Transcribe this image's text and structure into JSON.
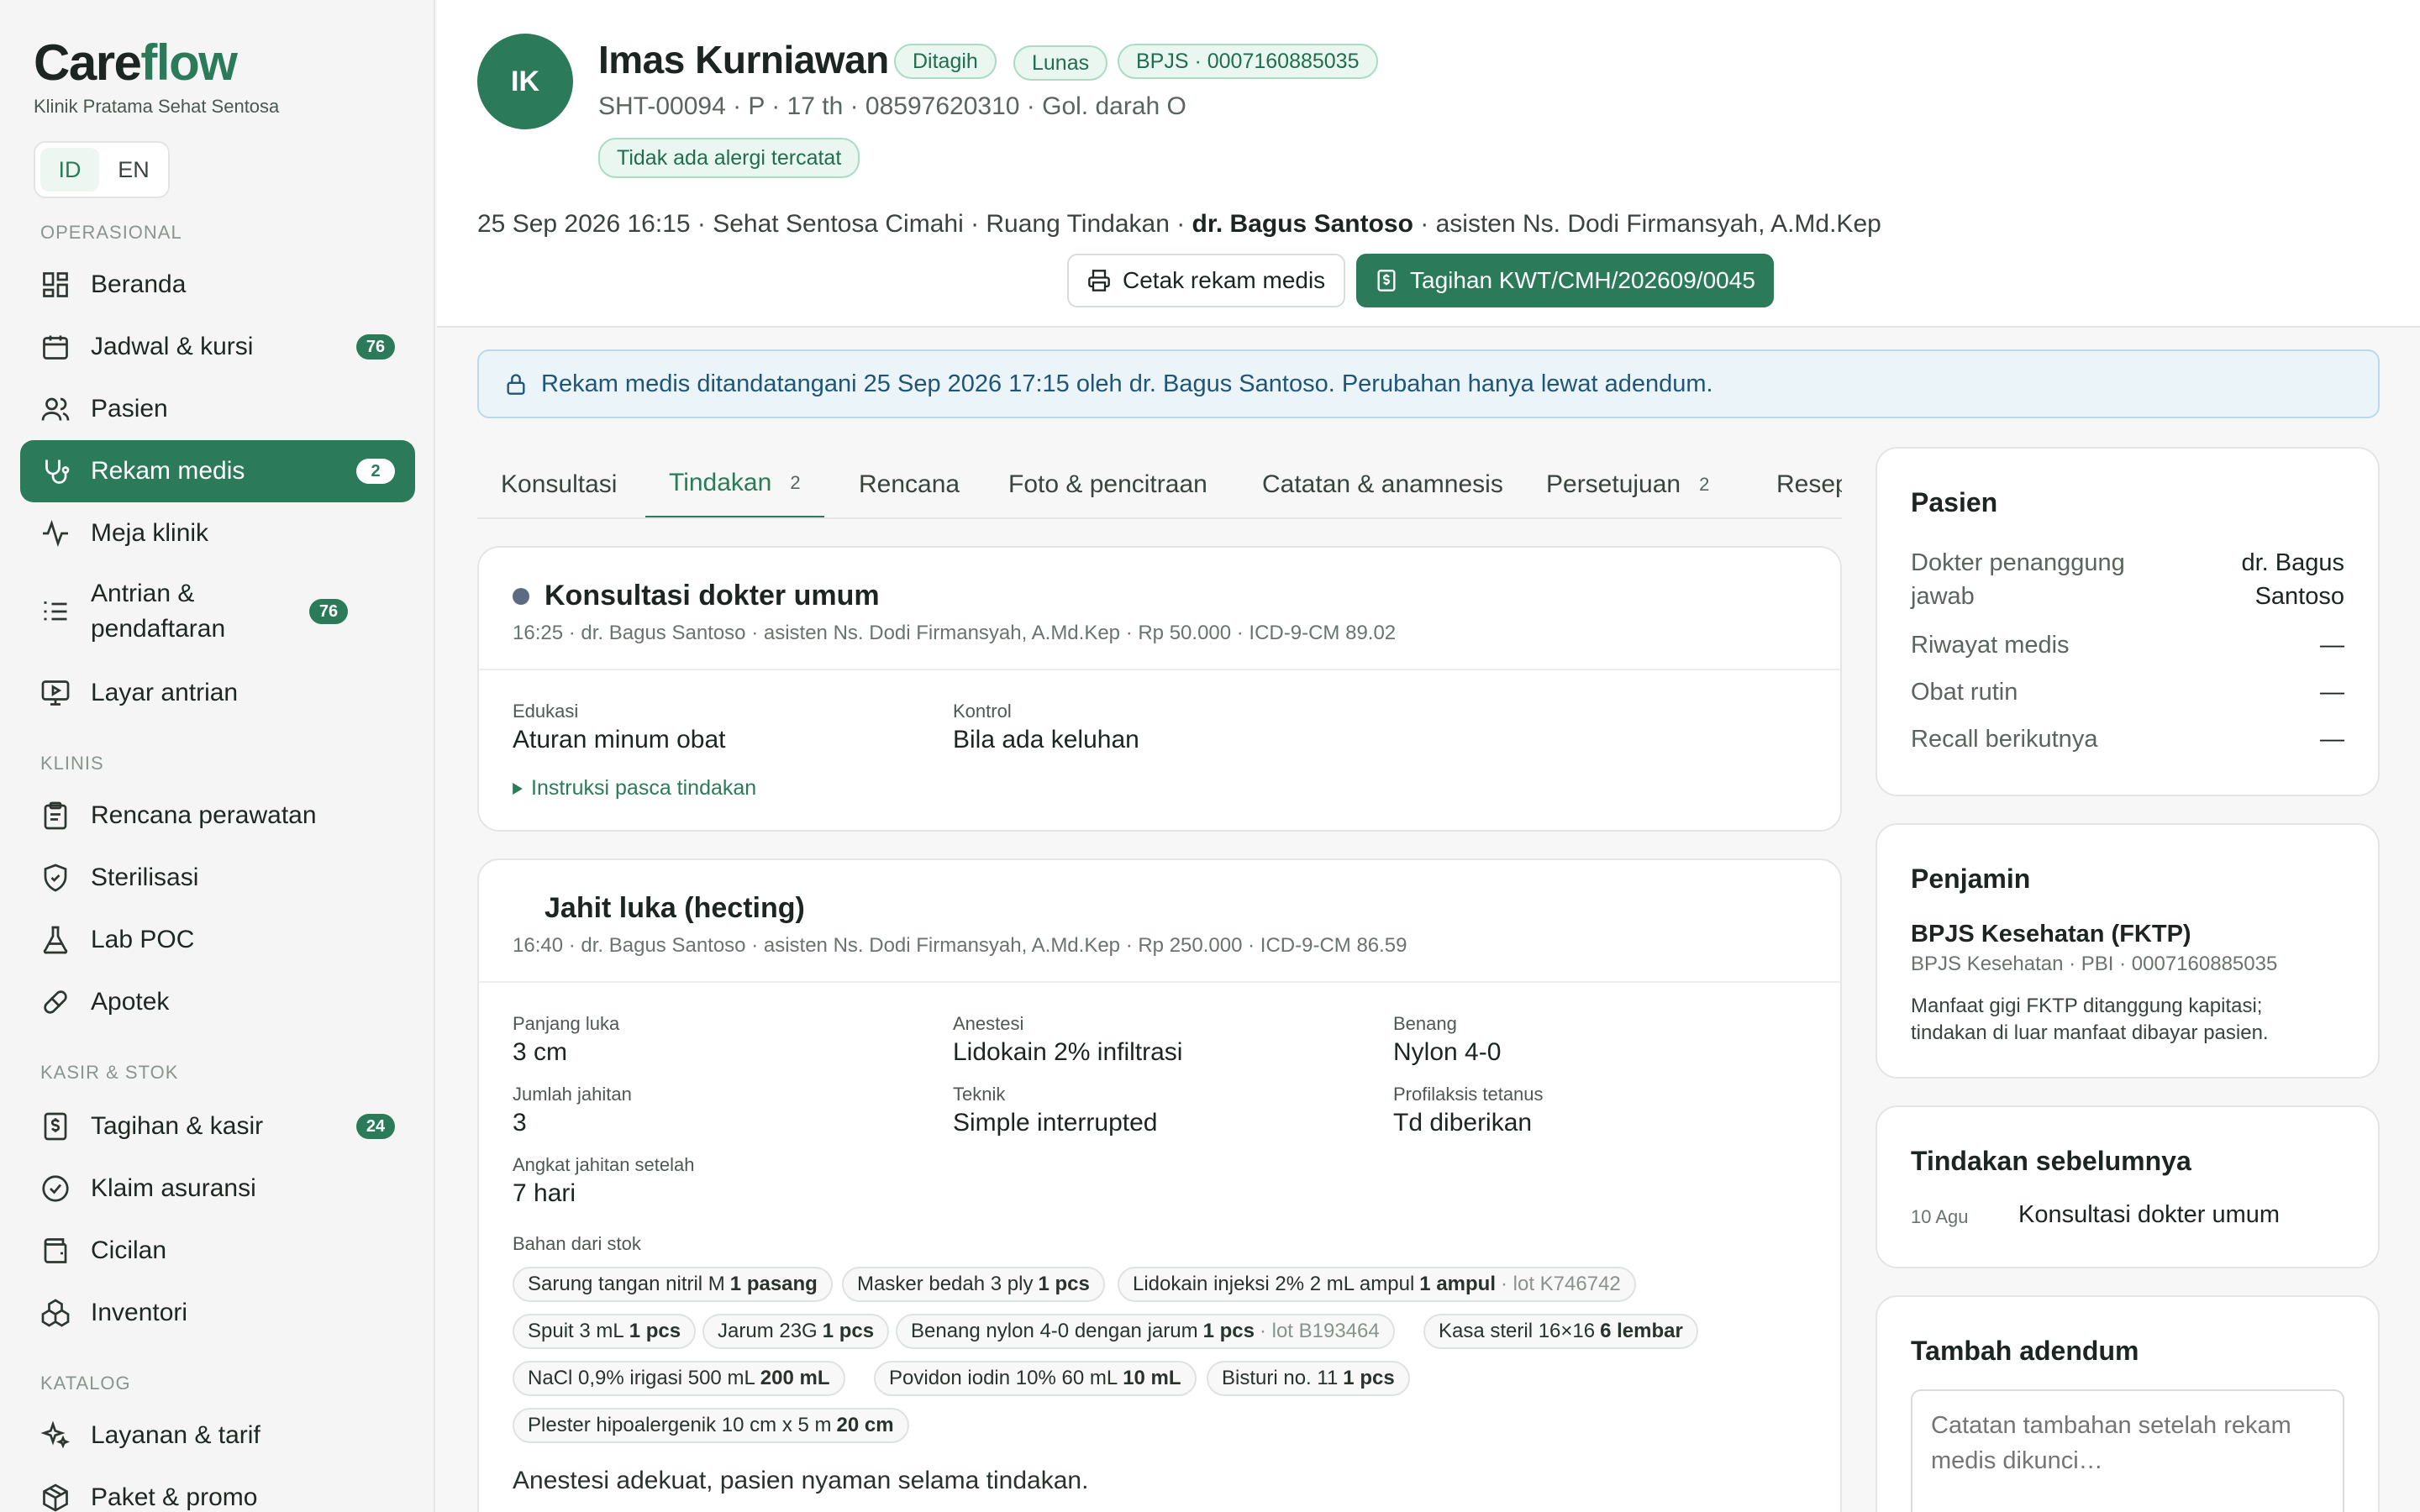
{
  "app": {
    "brand_part1": "Care",
    "brand_part2": "flow",
    "clinic": "Klinik Pratama Sehat Sentosa",
    "lang": [
      "ID",
      "EN"
    ]
  },
  "sidebar": {
    "sections": {
      "operasional": "OPERASIONAL",
      "klinis": "KLINIS",
      "kasir": "KASIR & STOK",
      "katalog": "KATALOG"
    },
    "items": [
      {
        "label": "Beranda",
        "icon": "dashboard-icon"
      },
      {
        "label": "Jadwal & kursi",
        "badge": "76",
        "icon": "calendar-icon"
      },
      {
        "label": "Pasien",
        "icon": "users-icon"
      },
      {
        "label": "Rekam medis",
        "badge": "2",
        "icon": "stethoscope-icon"
      },
      {
        "label": "Meja klinik",
        "icon": "activity-icon"
      },
      {
        "label": "Antrian & pendaftaran",
        "badge": "76",
        "icon": "queue-icon"
      },
      {
        "label": "Layar antrian",
        "icon": "monitor-icon"
      },
      {
        "label": "Rencana perawatan",
        "icon": "clipboard-icon"
      },
      {
        "label": "Sterilisasi",
        "icon": "shield-icon"
      },
      {
        "label": "Lab POC",
        "icon": "flask-icon"
      },
      {
        "label": "Apotek",
        "icon": "pill-icon"
      },
      {
        "label": "Tagihan & kasir",
        "badge": "24",
        "icon": "receipt-icon"
      },
      {
        "label": "Klaim asuransi",
        "icon": "check-circle-icon"
      },
      {
        "label": "Cicilan",
        "icon": "wallet-icon"
      },
      {
        "label": "Inventori",
        "icon": "boxes-icon"
      },
      {
        "label": "Layanan & tarif",
        "icon": "sparkle-icon"
      },
      {
        "label": "Paket & promo",
        "icon": "package-icon"
      }
    ]
  },
  "patient": {
    "initials": "IK",
    "name": "Imas Kurniawan",
    "badges": [
      "Ditagih",
      "Lunas",
      "BPJS · 0007160885035"
    ],
    "sub": "SHT-00094 · P · 17 th · 08597620310 · Gol. darah O",
    "allergy": "Tidak ada alergi tercatat",
    "visit_pre": "25 Sep 2026 16:15 · Sehat Sentosa Cimahi · Ruang Tindakan · ",
    "visit_doctor": "dr. Bagus Santoso",
    "visit_post": " · asisten Ns. Dodi Firmansyah, A.Md.Kep",
    "print_btn": "Cetak rekam medis",
    "bill_btn": "Tagihan KWT/CMH/202609/0045"
  },
  "banner": "Rekam medis ditandatangani 25 Sep 2026 17:15 oleh dr. Bagus Santoso. Perubahan hanya lewat adendum.",
  "tabs": [
    {
      "label": "Konsultasi"
    },
    {
      "label": "Tindakan",
      "count": "2"
    },
    {
      "label": "Rencana"
    },
    {
      "label": "Foto & pencitraan"
    },
    {
      "label": "Catatan & anamnesis"
    },
    {
      "label": "Persetujuan",
      "count": "2"
    },
    {
      "label": "Resep"
    }
  ],
  "proc1": {
    "title": "Konsultasi dokter umum",
    "meta": "16:25 · dr. Bagus Santoso · asisten Ns. Dodi Firmansyah, A.Md.Kep · Rp 50.000 · ICD-9-CM 89.02",
    "fields": [
      {
        "label": "Edukasi",
        "value": "Aturan minum obat"
      },
      {
        "label": "Kontrol",
        "value": "Bila ada keluhan"
      }
    ],
    "link": "Instruksi pasca tindakan"
  },
  "proc2": {
    "title": "Jahit luka (hecting)",
    "meta": "16:40 · dr. Bagus Santoso · asisten Ns. Dodi Firmansyah, A.Md.Kep · Rp 250.000 · ICD-9-CM 86.59",
    "fields": [
      {
        "label": "Panjang luka",
        "value": "3 cm"
      },
      {
        "label": "Anestesi",
        "value": "Lidokain 2% infiltrasi"
      },
      {
        "label": "Benang",
        "value": "Nylon 4-0"
      },
      {
        "label": "Jumlah jahitan",
        "value": "3"
      },
      {
        "label": "Teknik",
        "value": "Simple interrupted"
      },
      {
        "label": "Profilaksis tetanus",
        "value": "Td diberikan"
      },
      {
        "label": "Angkat jahitan setelah",
        "value": "7 hari"
      }
    ],
    "stock_label": "Bahan dari stok",
    "chips": [
      {
        "name": "Sarung tangan nitril M",
        "qty": "1 pasang"
      },
      {
        "name": "Masker bedah 3 ply",
        "qty": "1 pcs"
      },
      {
        "name": "Lidokain injeksi 2% 2 mL ampul",
        "qty": "1 ampul",
        "lot": "· lot K746742"
      },
      {
        "name": "Spuit 3 mL",
        "qty": "1 pcs"
      },
      {
        "name": "Jarum 23G",
        "qty": "1 pcs"
      },
      {
        "name": "Benang nylon 4-0 dengan jarum",
        "qty": "1 pcs",
        "lot": "· lot B193464"
      },
      {
        "name": "Kasa steril 16×16",
        "qty": "6 lembar"
      },
      {
        "name": "NaCl 0,9% irigasi 500 mL",
        "qty": "200 mL"
      },
      {
        "name": "Povidon iodin 10% 60 mL",
        "qty": "10 mL"
      },
      {
        "name": "Bisturi no. 11",
        "qty": "1 pcs"
      },
      {
        "name": "Plester hipoalergenik 10 cm x 5 m",
        "qty": "20 cm"
      }
    ],
    "note": "Anestesi adekuat, pasien nyaman selama tindakan."
  },
  "right": {
    "pasien": {
      "title": "Pasien",
      "rows": [
        {
          "k": "Dokter penanggung jawab",
          "v": "dr. Bagus Santoso"
        },
        {
          "k": "Riwayat medis",
          "v": "—"
        },
        {
          "k": "Obat rutin",
          "v": "—"
        },
        {
          "k": "Recall berikutnya",
          "v": "—"
        }
      ]
    },
    "penjamin": {
      "title": "Penjamin",
      "name": "BPJS Kesehatan (FKTP)",
      "sub": "BPJS Kesehatan · PBI · 0007160885035",
      "desc": "Manfaat gigi FKTP ditanggung kapitasi; tindakan di luar manfaat dibayar pasien."
    },
    "sebelumnya": {
      "title": "Tindakan sebelumnya",
      "date": "10 Agu",
      "name": "Konsultasi dokter umum"
    },
    "adendum": {
      "title": "Tambah adendum",
      "placeholder": "Catatan tambahan setelah rekam medis dikunci…"
    }
  }
}
